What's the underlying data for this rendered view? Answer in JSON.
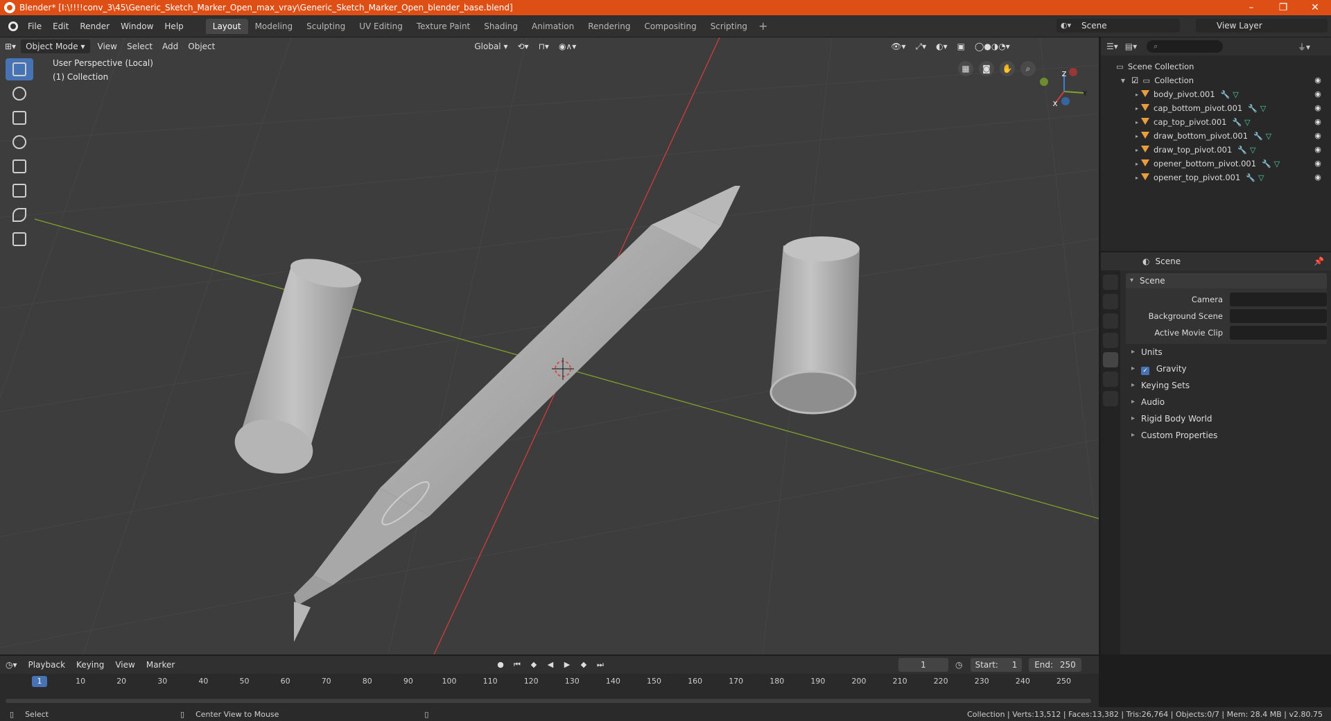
{
  "window": {
    "title": "Blender* [I:\\!!!!conv_3\\45\\Generic_Sketch_Marker_Open_max_vray\\Generic_Sketch_Marker_Open_blender_base.blend]",
    "minimize": "–",
    "maximize": "❐",
    "close": "✕"
  },
  "menu": [
    "File",
    "Edit",
    "Render",
    "Window",
    "Help"
  ],
  "workspaces": [
    "Layout",
    "Modeling",
    "Sculpting",
    "UV Editing",
    "Texture Paint",
    "Shading",
    "Animation",
    "Rendering",
    "Compositing",
    "Scripting"
  ],
  "workspace_add": "+",
  "scene_selector": "Scene",
  "view_layer_selector": "View Layer",
  "viewport": {
    "mode": "Object Mode",
    "menus": [
      "View",
      "Select",
      "Add",
      "Object"
    ],
    "transform_orientation": "Global",
    "overlay_line1": "User Perspective (Local)",
    "overlay_line2": "(1) Collection",
    "gizmo_axes": [
      "X",
      "Y",
      "Z"
    ]
  },
  "outliner": {
    "search_placeholder": "⌕",
    "root": "Scene Collection",
    "collection": "Collection",
    "objects": [
      "body_pivot.001",
      "cap_bottom_pivot.001",
      "cap_top_pivot.001",
      "draw_bottom_pivot.001",
      "draw_top_pivot.001",
      "opener_bottom_pivot.001",
      "opener_top_pivot.001"
    ]
  },
  "properties": {
    "header": "Scene",
    "panel_title": "Scene",
    "fields": [
      {
        "label": "Camera"
      },
      {
        "label": "Background Scene"
      },
      {
        "label": "Active Movie Clip"
      }
    ],
    "sections": [
      "Units",
      "Gravity",
      "Keying Sets",
      "Audio",
      "Rigid Body World",
      "Custom Properties"
    ],
    "gravity_checked": true
  },
  "timeline": {
    "menus": [
      "Playback",
      "Keying",
      "View",
      "Marker"
    ],
    "current_frame": "1",
    "start_label": "Start:",
    "start": "1",
    "end_label": "End:",
    "end": "250",
    "ruler_ticks": [
      "10",
      "20",
      "30",
      "40",
      "50",
      "60",
      "70",
      "80",
      "90",
      "100",
      "110",
      "120",
      "130",
      "140",
      "150",
      "160",
      "170",
      "180",
      "190",
      "200",
      "210",
      "220",
      "230",
      "240",
      "250"
    ]
  },
  "statusbar": {
    "left": "Select",
    "middle": "Center View to Mouse",
    "stats": "Collection | Verts:13,512 | Faces:13,382 | Tris:26,764 | Objects:0/7 | Mem: 28.4 MB | v2.80.75"
  },
  "colors": {
    "titlebar": "#de4f15",
    "accent": "#4772b3",
    "x_axis": "#d03c3c",
    "y_axis": "#7fa32b"
  }
}
